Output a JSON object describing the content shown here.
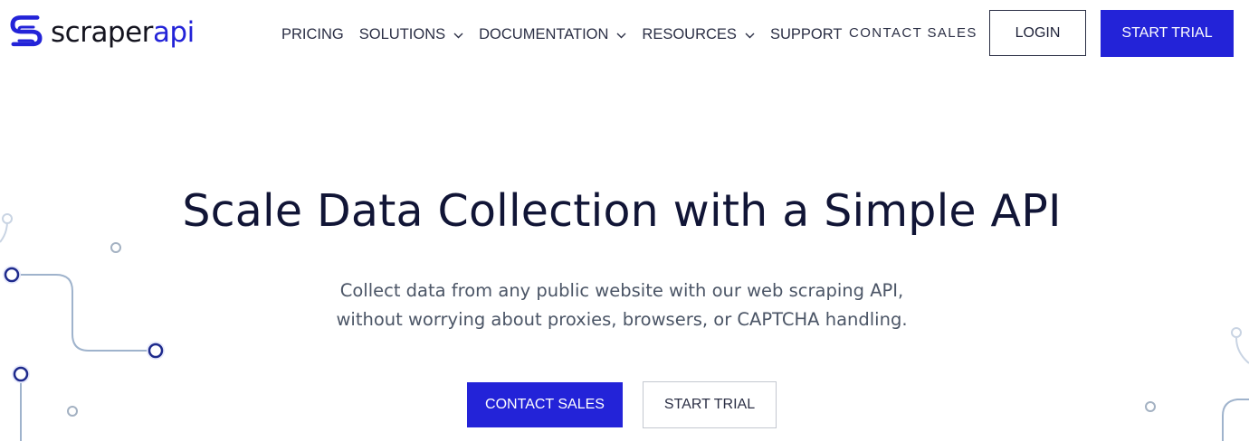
{
  "brand": {
    "name_part1": "scraper",
    "name_part2": "api",
    "primary_color": "#2323d8",
    "logo_icon": "scraperapi-s-logo-icon"
  },
  "nav": {
    "items": [
      {
        "label": "PRICING",
        "has_dropdown": false
      },
      {
        "label": "SOLUTIONS",
        "has_dropdown": true
      },
      {
        "label": "DOCUMENTATION",
        "has_dropdown": true
      },
      {
        "label": "RESOURCES",
        "has_dropdown": true
      },
      {
        "label": "SUPPORT",
        "has_dropdown": false
      }
    ],
    "contact_sales": "CONTACT SALES",
    "login": "LOGIN",
    "start_trial": "START TRIAL"
  },
  "hero": {
    "title": "Scale Data Collection with a Simple API",
    "subtitle_line1": "Collect data from any public website with our web scraping API,",
    "subtitle_line2": "without worrying about proxies, browsers, or CAPTCHA handling.",
    "cta_primary": "CONTACT SALES",
    "cta_secondary": "START TRIAL"
  }
}
